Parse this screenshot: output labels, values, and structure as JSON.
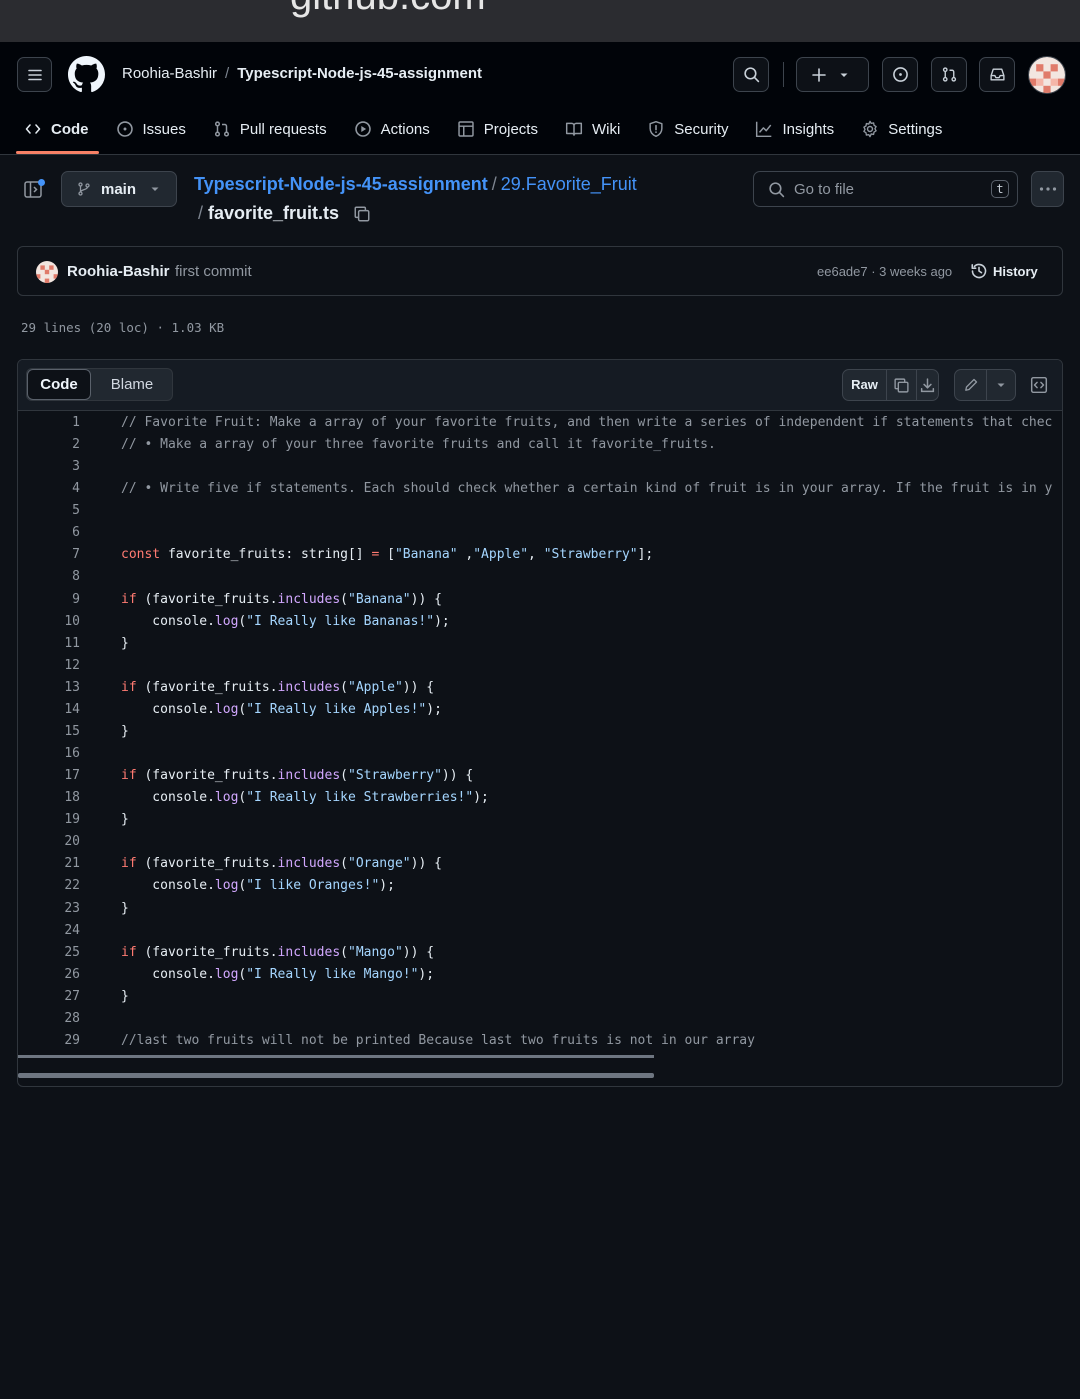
{
  "browser": {
    "url": "github.com"
  },
  "header": {
    "owner": "Roohia-Bashir",
    "separator": "/",
    "repo": "Typescript-Node-js-45-assignment"
  },
  "tabs": [
    {
      "label": "Code",
      "icon": "code-icon"
    },
    {
      "label": "Issues",
      "icon": "issue-icon"
    },
    {
      "label": "Pull requests",
      "icon": "pull-request-icon"
    },
    {
      "label": "Actions",
      "icon": "play-icon"
    },
    {
      "label": "Projects",
      "icon": "table-icon"
    },
    {
      "label": "Wiki",
      "icon": "book-icon"
    },
    {
      "label": "Security",
      "icon": "shield-icon"
    },
    {
      "label": "Insights",
      "icon": "graph-icon"
    },
    {
      "label": "Settings",
      "icon": "gear-icon"
    }
  ],
  "path": {
    "branch": "main",
    "repo_link": "Typescript-Node-js-45-assignment",
    "slash": "/",
    "folder_link": "29.Favorite_Fruit",
    "file": "favorite_fruit.ts",
    "go_to_file_placeholder": "Go to file",
    "shortcut_key": "t"
  },
  "commit": {
    "author": "Roohia-Bashir",
    "message": "first commit",
    "sha_time": "ee6ade7 · 3 weeks ago",
    "history_label": "History"
  },
  "file_info": "29 lines (20 loc) · 1.03 KB",
  "viewer": {
    "code_tab": "Code",
    "blame_tab": "Blame",
    "raw_label": "Raw"
  },
  "code_lines": [
    "// Favorite Fruit: Make a array of your favorite fruits, and then write a series of independent if statements that chec",
    "// • Make a array of your three favorite fruits and call it favorite_fruits.",
    "",
    "// • Write five if statements. Each should check whether a certain kind of fruit is in your array. If the fruit is in y",
    "",
    "",
    "const favorite_fruits: string[] = [\"Banana\" ,\"Apple\", \"Strawberry\"];",
    "",
    "if (favorite_fruits.includes(\"Banana\")) {",
    "    console.log(\"I Really like Bananas!\");",
    "}",
    "",
    "if (favorite_fruits.includes(\"Apple\")) {",
    "    console.log(\"I Really like Apples!\");",
    "}",
    "",
    "if (favorite_fruits.includes(\"Strawberry\")) {",
    "    console.log(\"I Really like Strawberries!\");",
    "}",
    "",
    "if (favorite_fruits.includes(\"Orange\")) {",
    "    console.log(\"I like Oranges!\");",
    "}",
    "",
    "if (favorite_fruits.includes(\"Mango\")) {",
    "    console.log(\"I Really like Mango!\");",
    "}",
    "",
    "//last two fruits will not be printed Because last two fruits is not in our array"
  ]
}
